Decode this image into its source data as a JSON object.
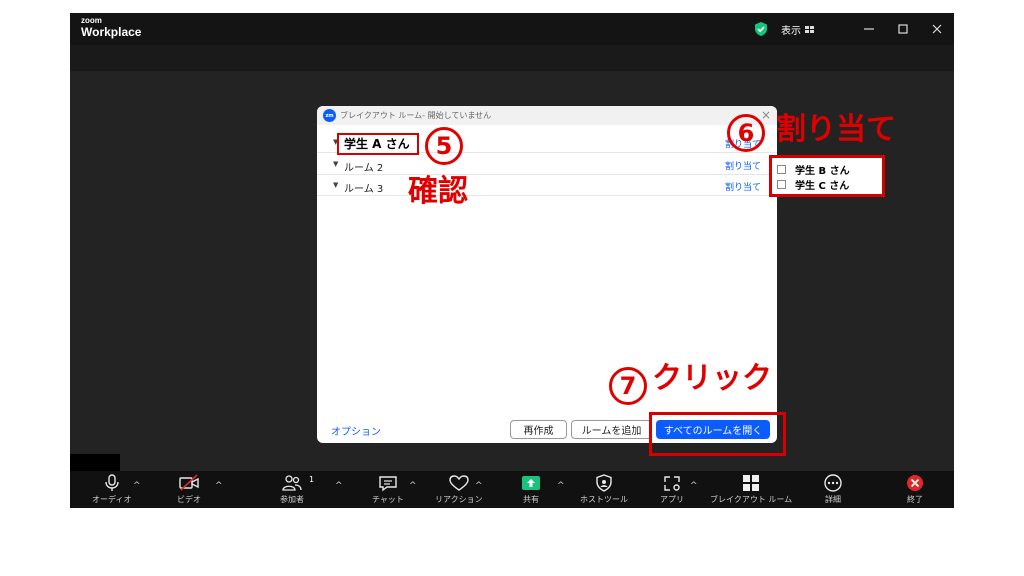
{
  "app": {
    "brand_small": "zoom",
    "brand_big": "Workplace",
    "view_label": "表示"
  },
  "dialog": {
    "title": "ブレイクアウト ルーム- 開始していません",
    "rooms": [
      {
        "name": "",
        "assign": "割り当て"
      },
      {
        "name": "ルーム 2",
        "assign": "割り当て"
      },
      {
        "name": "ルーム 3",
        "assign": "割り当て"
      }
    ],
    "student_a": "学生 A さん",
    "options_link": "オプション",
    "recreate": "再作成",
    "add_room": "ルームを追加",
    "open_all": "すべてのルームを開く"
  },
  "assign_popup": {
    "items": [
      "学生 B さん",
      "学生 C さん"
    ]
  },
  "annotations": {
    "step5_num": "5",
    "step5_text": "確認",
    "step6_num": "6",
    "step6_text": "割り当て",
    "step7_num": "7",
    "step7_text": "クリック"
  },
  "toolbar": {
    "audio": "オーディオ",
    "video": "ビデオ",
    "participants": "参加者",
    "participants_count": "1",
    "chat": "チャット",
    "reactions": "リアクション",
    "share": "共有",
    "host_tools": "ホストツール",
    "apps": "アプリ",
    "breakout": "ブレイクアウト ルーム",
    "more": "詳細",
    "end": "終了"
  },
  "colors": {
    "accent": "#0b5cff",
    "annotation": "#e00000",
    "share_green": "#19c37d",
    "end_red": "#e02828"
  }
}
